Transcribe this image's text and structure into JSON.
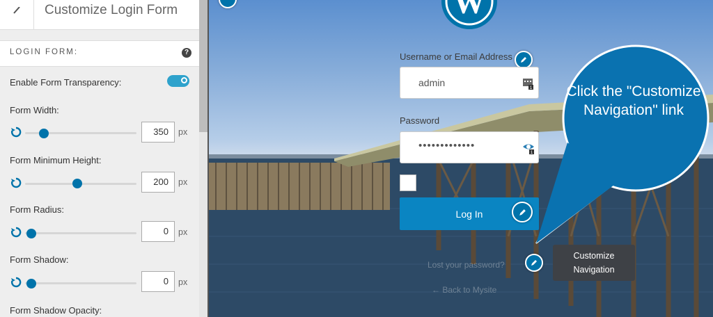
{
  "panel": {
    "title": "Customize Login Form",
    "section_title": "LOGIN FORM:",
    "transparency_label": "Enable Form Transparency:",
    "transparency_enabled": true,
    "settings": [
      {
        "label": "Form Width:",
        "value": "350",
        "unit": "px",
        "slider_fraction": 0.12
      },
      {
        "label": "Form Minimum Height:",
        "value": "200",
        "unit": "px",
        "slider_fraction": 0.44
      },
      {
        "label": "Form Radius:",
        "value": "0",
        "unit": "px",
        "slider_fraction": 0.0
      },
      {
        "label": "Form Shadow:",
        "value": "0",
        "unit": "px",
        "slider_fraction": 0.0
      }
    ],
    "next_label": "Form Shadow Opacity:"
  },
  "login": {
    "username_label": "Username or Email Address",
    "username_value": "admin",
    "password_label": "Password",
    "password_value": "•••••••••••••",
    "login_button": "Log In",
    "lost_password": "Lost your password?",
    "back_link": "← Back to Mysite"
  },
  "tooltip": {
    "line1": "Customize",
    "line2": "Navigation"
  },
  "callout": {
    "text": "Click the \"Customize Navigation\" link"
  },
  "colors": {
    "accent": "#0073aa",
    "callout": "#0a72b0",
    "button": "#0a85c2"
  }
}
